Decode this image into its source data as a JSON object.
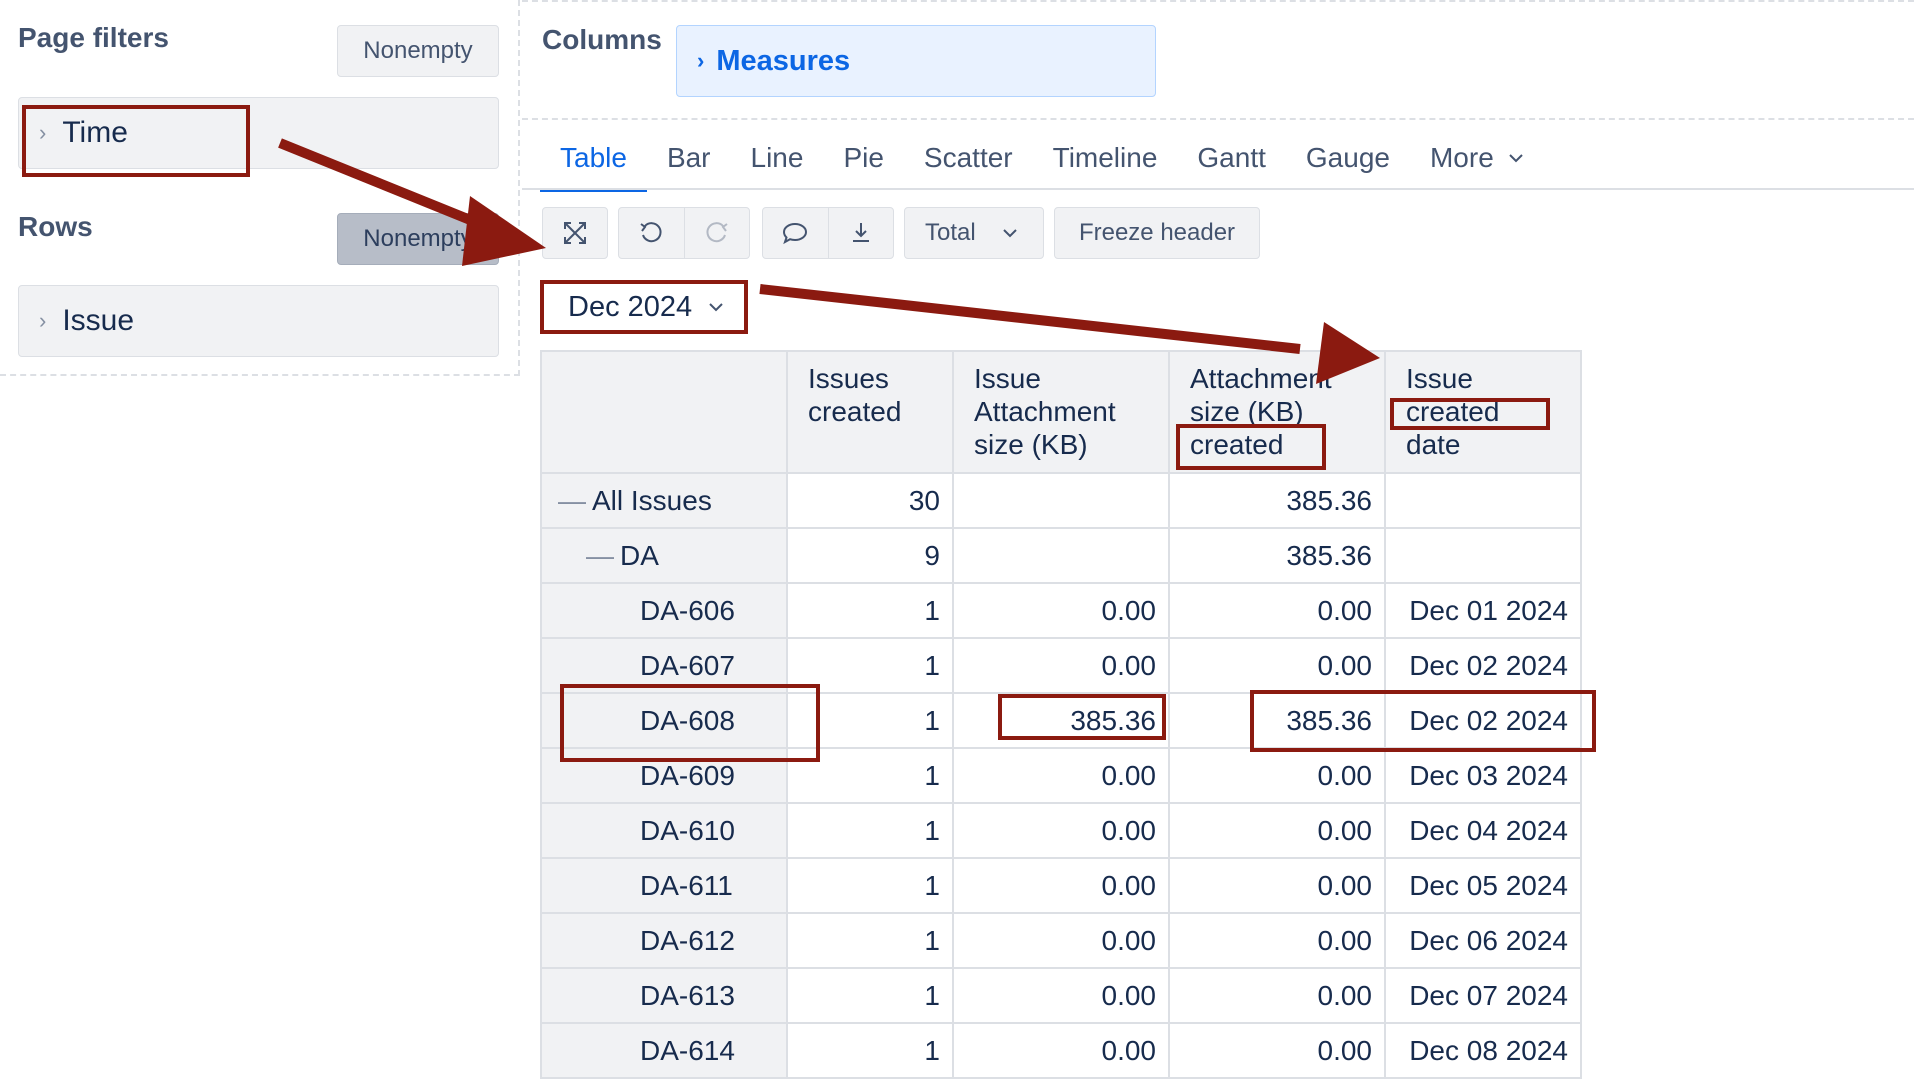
{
  "left_panel": {
    "page_filters_title": "Page filters",
    "page_filters_nonempty": "Nonempty",
    "time_label": "Time",
    "rows_title": "Rows",
    "rows_nonempty": "Nonempty",
    "issue_label": "Issue"
  },
  "columns": {
    "title": "Columns",
    "measures_label": "Measures"
  },
  "tabs": [
    {
      "label": "Table",
      "active": true
    },
    {
      "label": "Bar"
    },
    {
      "label": "Line"
    },
    {
      "label": "Pie"
    },
    {
      "label": "Scatter"
    },
    {
      "label": "Timeline"
    },
    {
      "label": "Gantt"
    },
    {
      "label": "Gauge"
    },
    {
      "label": "More"
    }
  ],
  "toolbar": {
    "total_label": "Total",
    "freeze_label": "Freeze header"
  },
  "time_selector": {
    "value": "Dec 2024"
  },
  "table": {
    "headers": [
      [
        "Issues",
        "created"
      ],
      [
        "Issue",
        "Attachment",
        "size (KB)"
      ],
      [
        "Attachment",
        "size (KB)",
        "created"
      ],
      [
        "Issue",
        "created",
        "date"
      ]
    ],
    "rows": [
      {
        "label": "All Issues",
        "expander": "—",
        "values": [
          "30",
          "",
          "385.36",
          ""
        ]
      },
      {
        "label": "DA",
        "expander": "—",
        "values": [
          "9",
          "",
          "385.36",
          ""
        ]
      },
      {
        "label": "DA-606",
        "values": [
          "1",
          "0.00",
          "0.00",
          "Dec 01 2024"
        ]
      },
      {
        "label": "DA-607",
        "values": [
          "1",
          "0.00",
          "0.00",
          "Dec 02 2024"
        ]
      },
      {
        "label": "DA-608",
        "values": [
          "1",
          "385.36",
          "385.36",
          "Dec 02 2024"
        ]
      },
      {
        "label": "DA-609",
        "values": [
          "1",
          "0.00",
          "0.00",
          "Dec 03 2024"
        ]
      },
      {
        "label": "DA-610",
        "values": [
          "1",
          "0.00",
          "0.00",
          "Dec 04 2024"
        ]
      },
      {
        "label": "DA-611",
        "values": [
          "1",
          "0.00",
          "0.00",
          "Dec 05 2024"
        ]
      },
      {
        "label": "DA-612",
        "values": [
          "1",
          "0.00",
          "0.00",
          "Dec 06 2024"
        ]
      },
      {
        "label": "DA-613",
        "values": [
          "1",
          "0.00",
          "0.00",
          "Dec 07 2024"
        ]
      },
      {
        "label": "DA-614",
        "values": [
          "1",
          "0.00",
          "0.00",
          "Dec 08 2024"
        ]
      }
    ]
  },
  "colors": {
    "accent": "#0c66e4",
    "annotation": "#8b1a10",
    "panel_bg": "#f1f2f4"
  }
}
